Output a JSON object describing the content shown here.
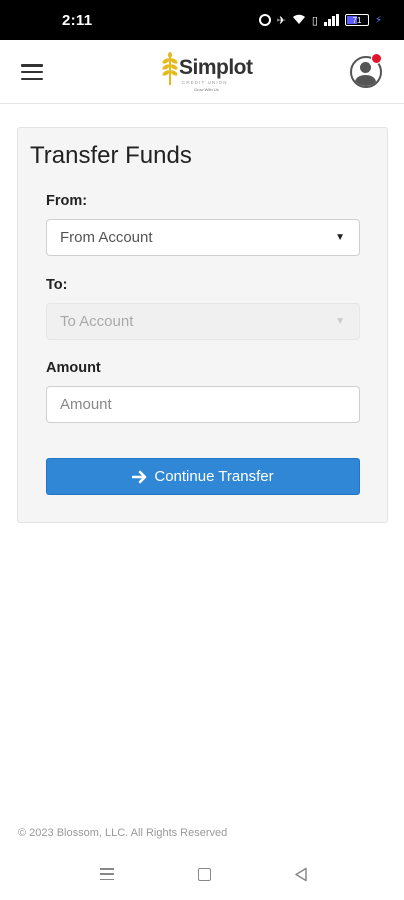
{
  "status_bar": {
    "time": "2:11",
    "battery": "71"
  },
  "header": {
    "logo_text": "Simplot",
    "logo_sub": "CREDIT UNION",
    "logo_tag": "Grow With Us"
  },
  "transfer": {
    "title": "Transfer Funds",
    "from_label": "From:",
    "from_value": "From Account",
    "to_label": "To:",
    "to_value": "To Account",
    "amount_label": "Amount",
    "amount_placeholder": "Amount",
    "continue_label": "Continue Transfer"
  },
  "footer": {
    "copyright": "© 2023 Blossom, LLC. All Rights Reserved"
  },
  "icons": {
    "menu": "hamburger-menu-icon",
    "avatar": "user-avatar-icon",
    "arrow": "arrow-right-icon",
    "nav_recent": "recent-apps-icon",
    "nav_home": "home-icon",
    "nav_back": "back-icon"
  },
  "colors": {
    "accent": "#2f87d5",
    "notification": "#e0162b",
    "logo_gold": "#e6b91e"
  }
}
